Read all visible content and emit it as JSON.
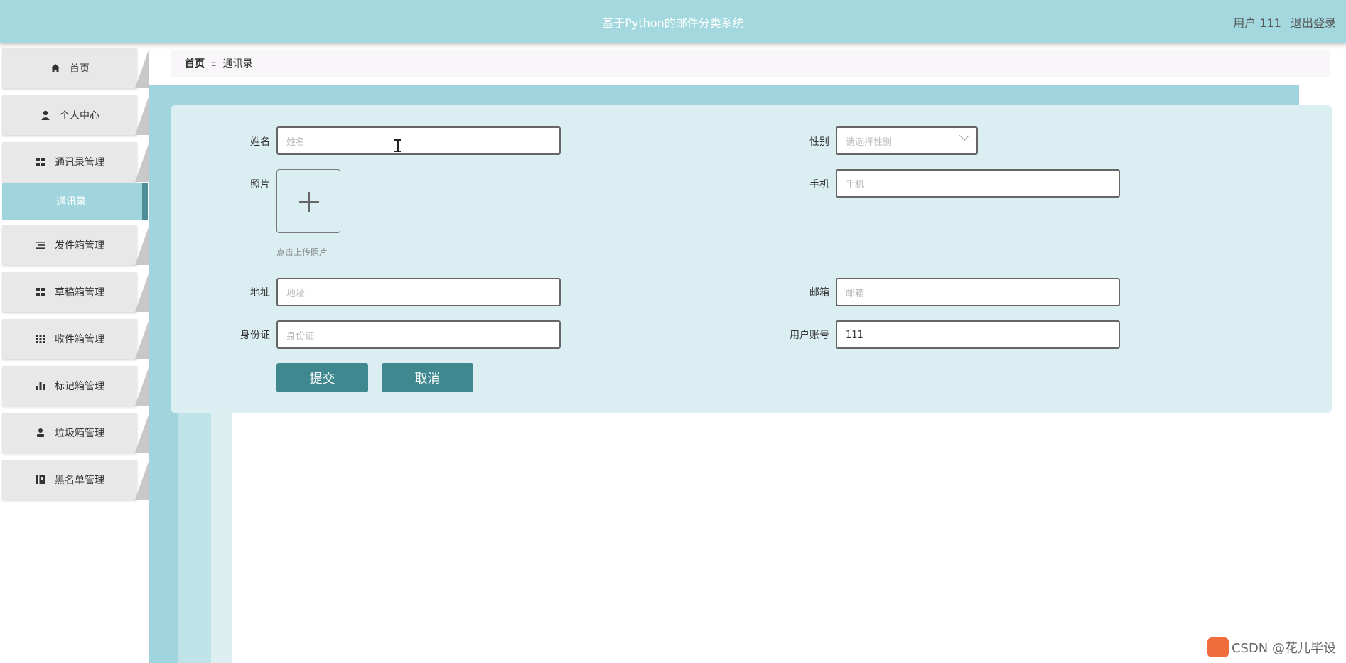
{
  "header": {
    "title": "基于Python的邮件分类系统",
    "user_label": "用户 111",
    "logout_label": "退出登录"
  },
  "sidebar": {
    "items": [
      {
        "label": "首页",
        "icon": "home-icon"
      },
      {
        "label": "个人中心",
        "icon": "person-icon"
      },
      {
        "label": "通讯录管理",
        "icon": "grid-icon"
      },
      {
        "label": "发件箱管理",
        "icon": "list-icon"
      },
      {
        "label": "草稿箱管理",
        "icon": "grid-icon"
      },
      {
        "label": "收件箱管理",
        "icon": "apps-icon"
      },
      {
        "label": "标记箱管理",
        "icon": "bar-chart-icon"
      },
      {
        "label": "垃圾箱管理",
        "icon": "user-icon"
      },
      {
        "label": "黑名单管理",
        "icon": "book-icon"
      }
    ],
    "active_subitem": "通讯录"
  },
  "breadcrumb": {
    "home": "首页",
    "separator": "Ξ",
    "current": "通讯录"
  },
  "form": {
    "name": {
      "label": "姓名",
      "placeholder": "姓名",
      "value": ""
    },
    "gender": {
      "label": "性别",
      "placeholder": "请选择性别",
      "value": ""
    },
    "photo": {
      "label": "照片",
      "tip": "点击上传照片"
    },
    "phone": {
      "label": "手机",
      "placeholder": "手机",
      "value": ""
    },
    "address": {
      "label": "地址",
      "placeholder": "地址",
      "value": ""
    },
    "email": {
      "label": "邮箱",
      "placeholder": "邮箱",
      "value": ""
    },
    "id_card": {
      "label": "身份证",
      "placeholder": "身份证",
      "value": ""
    },
    "account": {
      "label": "用户账号",
      "value": "111"
    },
    "submit_label": "提交",
    "cancel_label": "取消"
  },
  "watermark": "CSDN @花儿毕设",
  "colors": {
    "header_bg": "#a2d8de",
    "panel_bg": "#dbeef1",
    "button_bg": "#3f8890",
    "active_menu": "#a0d5dd"
  }
}
